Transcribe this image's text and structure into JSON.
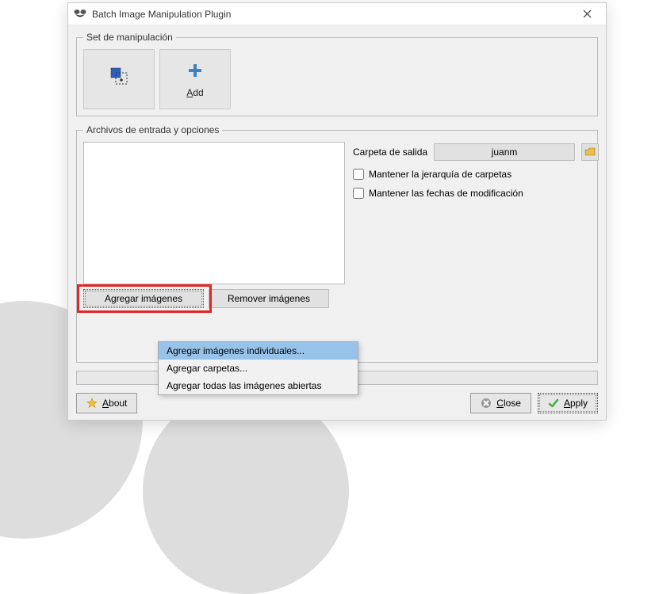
{
  "window": {
    "title": "Batch Image Manipulation Plugin"
  },
  "groups": {
    "manipulation_legend": "Set de manipulación",
    "input_legend": "Archivos de entrada y opciones"
  },
  "tools": {
    "selection_label": "",
    "add_label": "Add"
  },
  "buttons": {
    "add_images": "Agregar imágenes",
    "remove_images": "Remover imágenes",
    "about": "About",
    "close": "Close",
    "apply": "Apply"
  },
  "options": {
    "output_folder_label": "Carpeta de salida",
    "output_folder_value": "juanm",
    "keep_hierarchy": "Mantener la jerarquía de carpetas",
    "keep_dates": "Mantener las fechas de modificación"
  },
  "menu": {
    "add_individual": "Agregar imágenes individuales...",
    "add_folders": "Agregar carpetas...",
    "add_all_open": "Agregar todas las imágenes abiertas"
  }
}
